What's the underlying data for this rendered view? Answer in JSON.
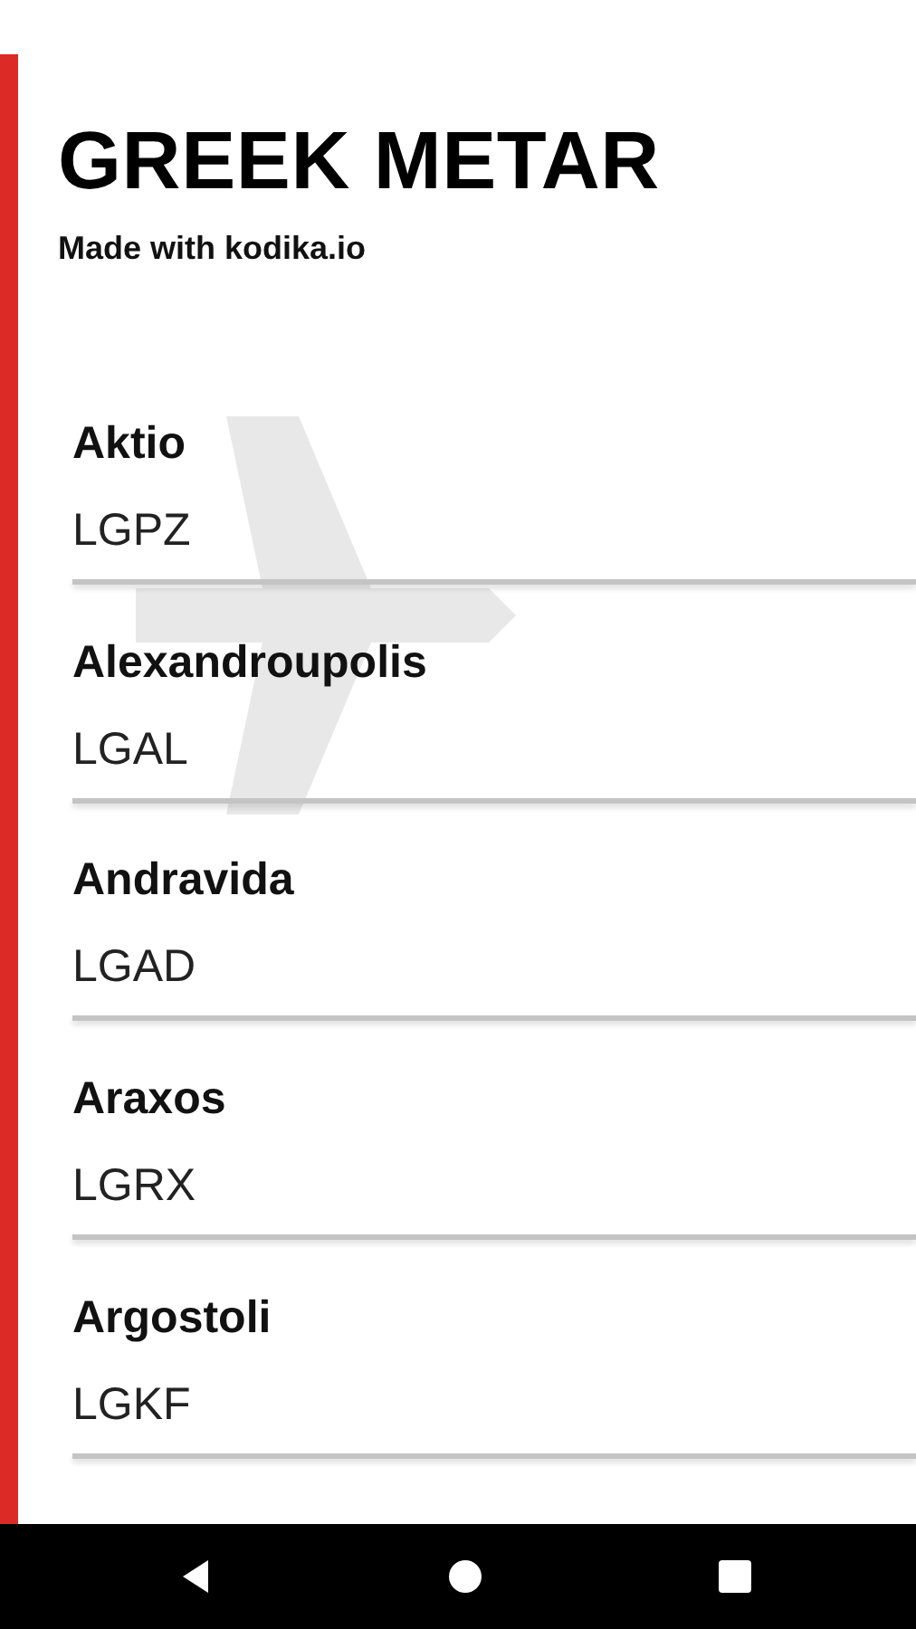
{
  "header": {
    "title": "GREEK METAR",
    "subtitle": "Made with kodika.io"
  },
  "airports": [
    {
      "name": "Aktio",
      "code": "LGPZ"
    },
    {
      "name": "Alexandroupolis",
      "code": "LGAL"
    },
    {
      "name": "Andravida",
      "code": "LGAD"
    },
    {
      "name": "Araxos",
      "code": "LGRX"
    },
    {
      "name": "Argostoli",
      "code": "LGKF"
    }
  ],
  "nav_bar": {
    "buttons": [
      {
        "kind": "back"
      },
      {
        "kind": "home"
      },
      {
        "kind": "recents"
      }
    ]
  }
}
